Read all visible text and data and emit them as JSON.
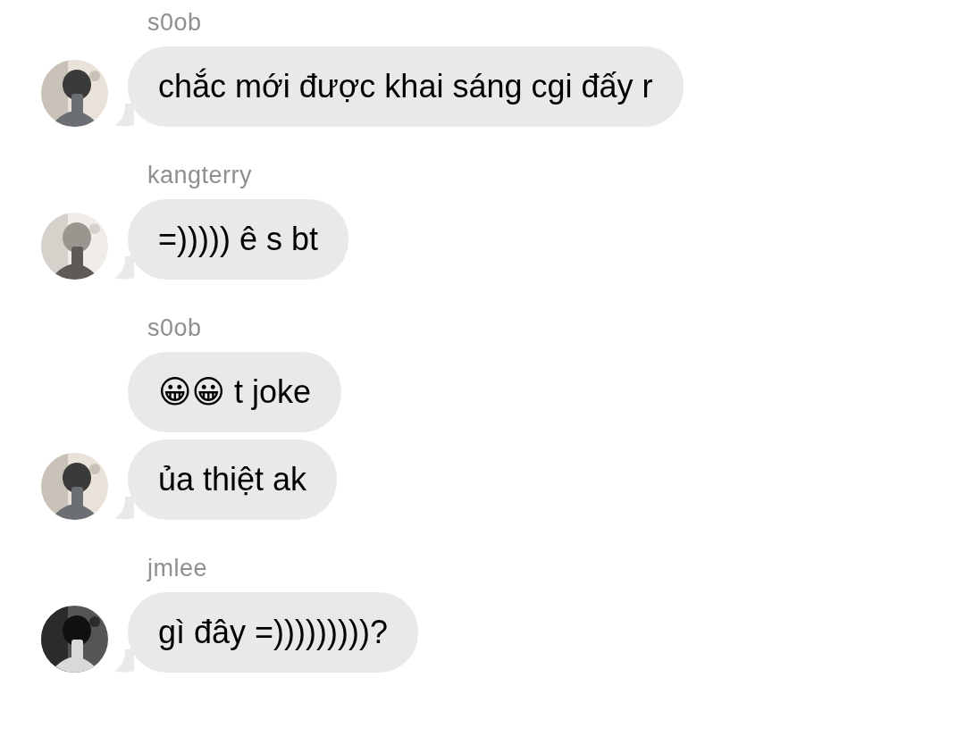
{
  "groups": [
    {
      "sender": "s0ob",
      "avatar": {
        "kind": "picture"
      },
      "messages": [
        {
          "text": "chắc mới được khai sáng cgi đấy r"
        }
      ]
    },
    {
      "sender": "kangterry",
      "avatar": {
        "kind": "picture"
      },
      "messages": [
        {
          "text": "=))))) ê s bt"
        }
      ]
    },
    {
      "sender": "s0ob",
      "avatar": {
        "kind": "picture"
      },
      "messages": [
        {
          "text": "😀😀 t joke"
        },
        {
          "text": "ủa thiệt ak"
        }
      ]
    },
    {
      "sender": "jmlee",
      "avatar": {
        "kind": "picture"
      },
      "messages": [
        {
          "text": "gì đây =)))))))))?"
        }
      ]
    }
  ]
}
